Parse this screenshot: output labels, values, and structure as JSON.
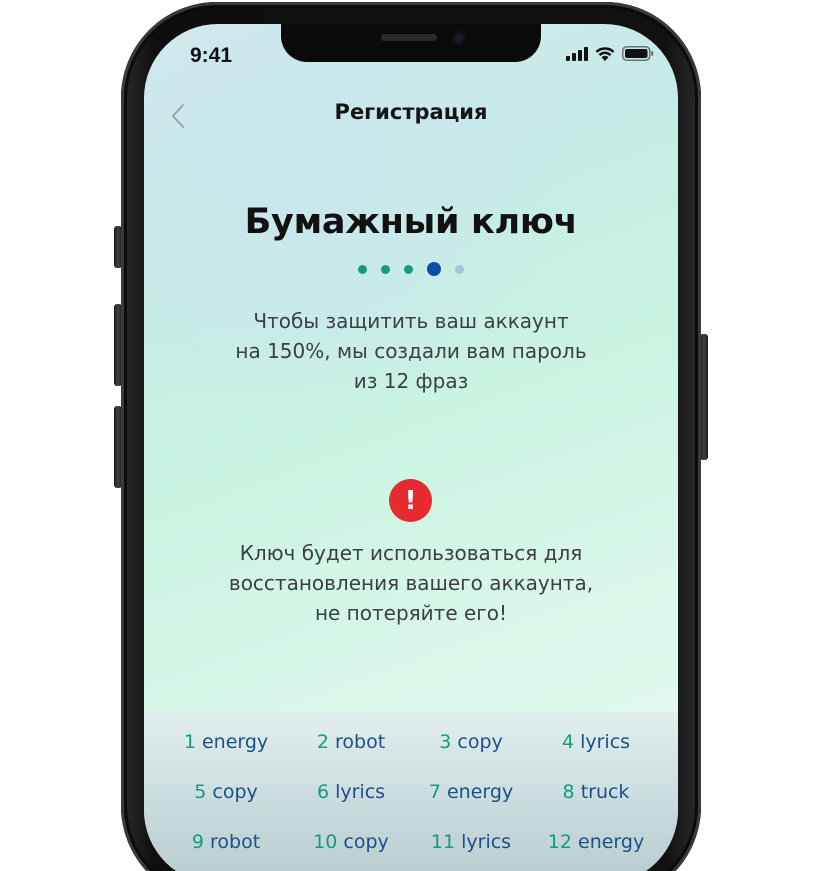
{
  "status_bar": {
    "time": "9:41",
    "icons": [
      "signal-icon",
      "wifi-icon",
      "battery-icon"
    ]
  },
  "header": {
    "back_icon": "chevron-left-icon",
    "title": "Регистрация"
  },
  "main": {
    "title": "Бумажный ключ",
    "pagination": {
      "total": 5,
      "current": 4
    },
    "description": "Чтобы защитить ваш аккаунт на 150%, мы создали вам пароль из 12 фраз",
    "description_lines": [
      "Чтобы защитить ваш аккаунт",
      "на 150%, мы создали вам пароль",
      "из 12 фраз"
    ],
    "warning_icon": "exclamation-icon",
    "warning_icon_glyph": "!",
    "warning_lines": [
      "Ключ будет использоваться для",
      "восстановления вашего аккаунта,",
      "не потеряйте его!"
    ]
  },
  "phrases": [
    {
      "num": "1",
      "word": "energy"
    },
    {
      "num": "2",
      "word": "robot"
    },
    {
      "num": "3",
      "word": "copy"
    },
    {
      "num": "4",
      "word": "lyrics"
    },
    {
      "num": "5",
      "word": "copy"
    },
    {
      "num": "6",
      "word": "lyrics"
    },
    {
      "num": "7",
      "word": "energy"
    },
    {
      "num": "8",
      "word": "truck"
    },
    {
      "num": "9",
      "word": "robot"
    },
    {
      "num": "10",
      "word": "copy"
    },
    {
      "num": "11",
      "word": "lyrics"
    },
    {
      "num": "12",
      "word": "energy"
    }
  ],
  "colors": {
    "accent_green": "#1a9b78",
    "accent_blue": "#0d4fa6",
    "word_blue": "#1c4f8c",
    "warning_red": "#e52a30"
  }
}
